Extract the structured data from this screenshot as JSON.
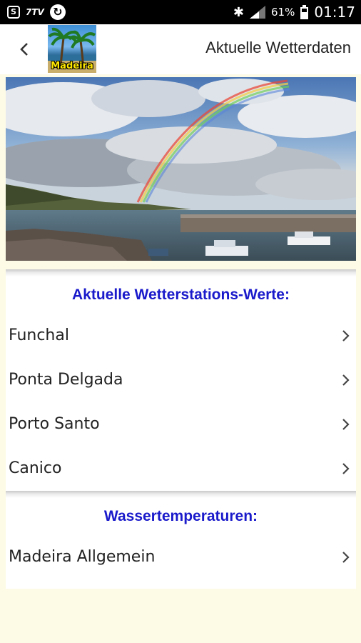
{
  "status_bar": {
    "left_icons": [
      "screenshot-icon",
      "carrier-icon",
      "sync-icon"
    ],
    "carrier_text": "7TV",
    "battery_percent": "61%",
    "time": "01:17"
  },
  "app_bar": {
    "title": "Aktuelle Wetterdaten",
    "logo_text": "Madeira"
  },
  "sections": [
    {
      "title": "Aktuelle Wetterstations-Werte:",
      "items": [
        "Funchal",
        "Ponta Delgada",
        "Porto Santo",
        "Canico"
      ]
    },
    {
      "title": "Wassertemperaturen:",
      "items": [
        "Madeira Allgemein"
      ]
    }
  ],
  "colors": {
    "section_title": "#1a1acb",
    "page_background": "#fdfbe6",
    "status_bar": "#000000"
  }
}
